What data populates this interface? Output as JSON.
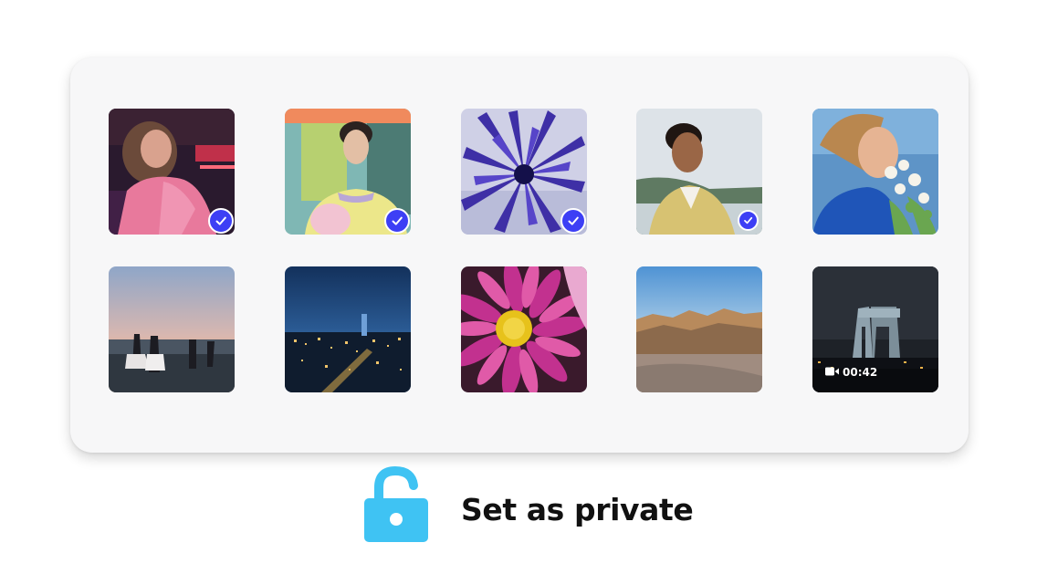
{
  "gallery": {
    "items": [
      {
        "name": "photo-girl-pink-shirt",
        "selected": true
      },
      {
        "name": "photo-woman-striped-sweater",
        "selected": true
      },
      {
        "name": "photo-blue-cornflower",
        "selected": true
      },
      {
        "name": "photo-man-yellow-jacket",
        "selected": true
      },
      {
        "name": "photo-woman-white-flowers",
        "selected": false
      },
      {
        "name": "photo-beach-sunset-friends",
        "selected": false
      },
      {
        "name": "photo-city-night-aerial",
        "selected": false
      },
      {
        "name": "photo-pink-daisy",
        "selected": false
      },
      {
        "name": "photo-desert-canyon",
        "selected": false
      },
      {
        "name": "video-night-building",
        "selected": false,
        "video": true,
        "duration": "00:42"
      }
    ]
  },
  "action": {
    "label": "Set as private",
    "icon": "unlocked-padlock-icon",
    "icon_color": "#3fc3f3"
  },
  "colors": {
    "selection_accent": "#3d3ff5",
    "card_background": "#f7f7f8"
  }
}
